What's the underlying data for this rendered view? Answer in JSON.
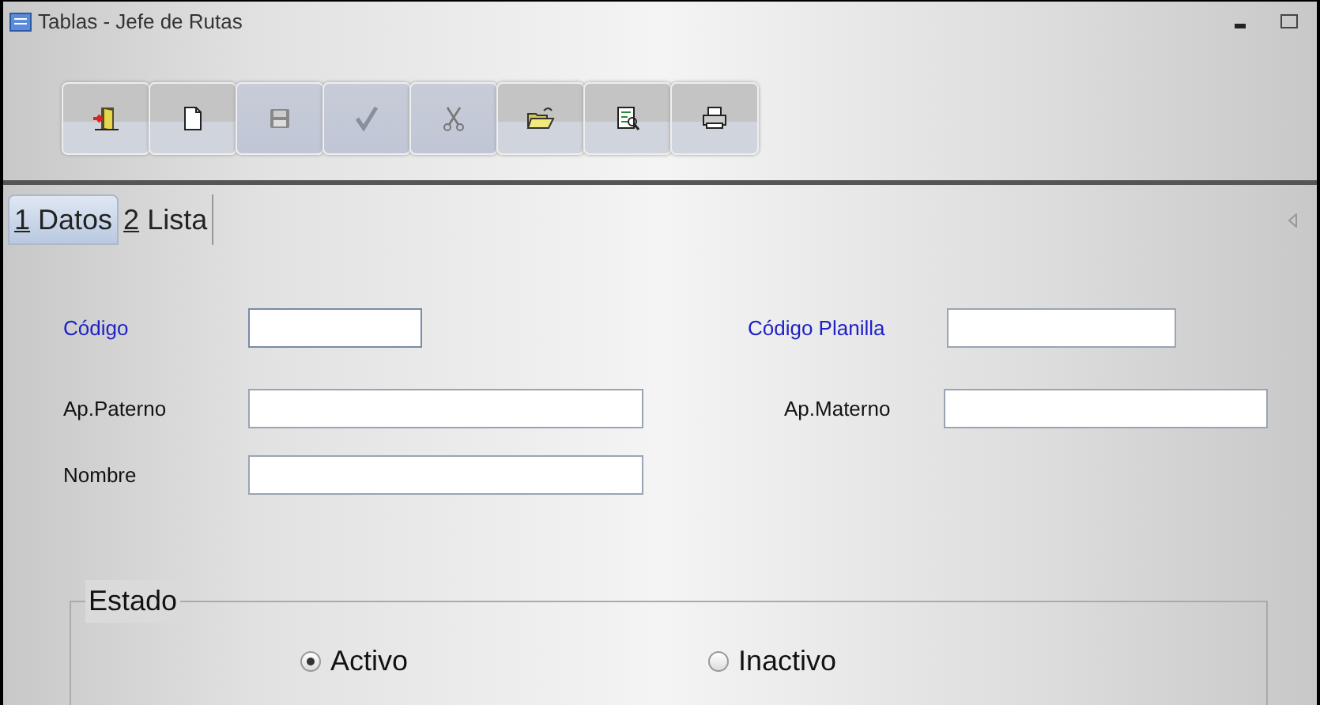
{
  "window": {
    "title": "Tablas - Jefe de Rutas"
  },
  "toolbar": [
    {
      "kind": "exit",
      "disabled": false
    },
    {
      "kind": "new",
      "disabled": false
    },
    {
      "kind": "save",
      "disabled": true
    },
    {
      "kind": "check",
      "disabled": true
    },
    {
      "kind": "cut",
      "disabled": true
    },
    {
      "kind": "open",
      "disabled": false
    },
    {
      "kind": "preview",
      "disabled": false
    },
    {
      "kind": "print",
      "disabled": false
    }
  ],
  "tabs": [
    {
      "label": "1 Datos",
      "selected": true
    },
    {
      "label": "2 Lista",
      "selected": false
    }
  ],
  "fields": [
    {
      "label": "Código",
      "required": true,
      "focused": true
    },
    {
      "label": "Código Planilla",
      "required": true,
      "focused": false
    },
    {
      "label": "Ap.Paterno",
      "required": false,
      "focused": false
    },
    {
      "label": "Ap.Materno",
      "required": false,
      "focused": false
    },
    {
      "label": "Nombre",
      "required": false,
      "focused": false
    }
  ],
  "estado": {
    "legend": "Estado",
    "options": [
      {
        "label": "Activo",
        "selected": true
      },
      {
        "label": "Inactivo",
        "selected": false
      }
    ]
  }
}
